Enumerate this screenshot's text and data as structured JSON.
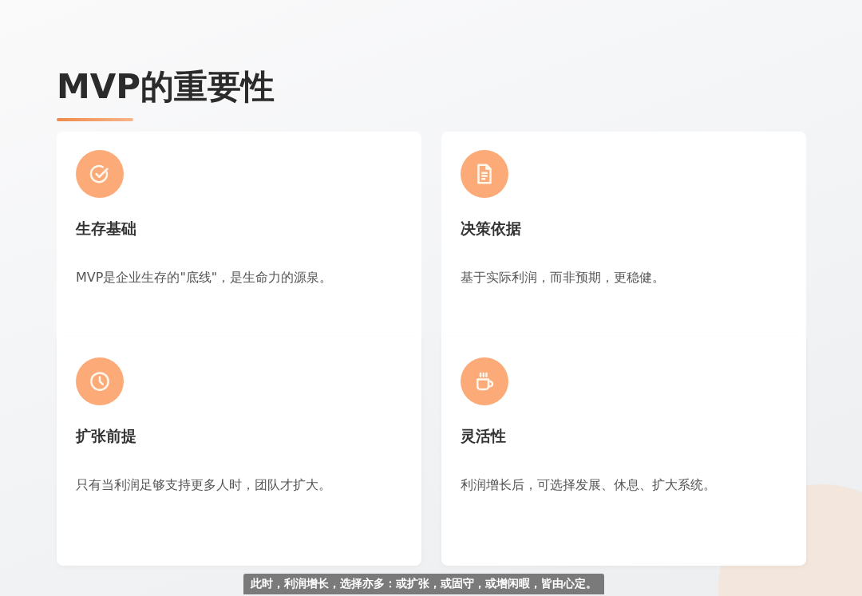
{
  "title": "MVP的重要性",
  "cards": [
    {
      "heading": "生存基础",
      "text": "MVP是企业生存的\"底线\"，是生命力的源泉。"
    },
    {
      "heading": "决策依据",
      "text": "基于实际利润，而非预期，更稳健。"
    },
    {
      "heading": "扩张前提",
      "text": "只有当利润足够支持更多人时，团队才扩大。"
    },
    {
      "heading": "灵活性",
      "text": "利润增长后，可选择发展、休息、扩大系统。"
    }
  ],
  "subtitle": "此时，利润增长，选择亦多：或扩张，或固守，或增闲暇，皆由心定。"
}
